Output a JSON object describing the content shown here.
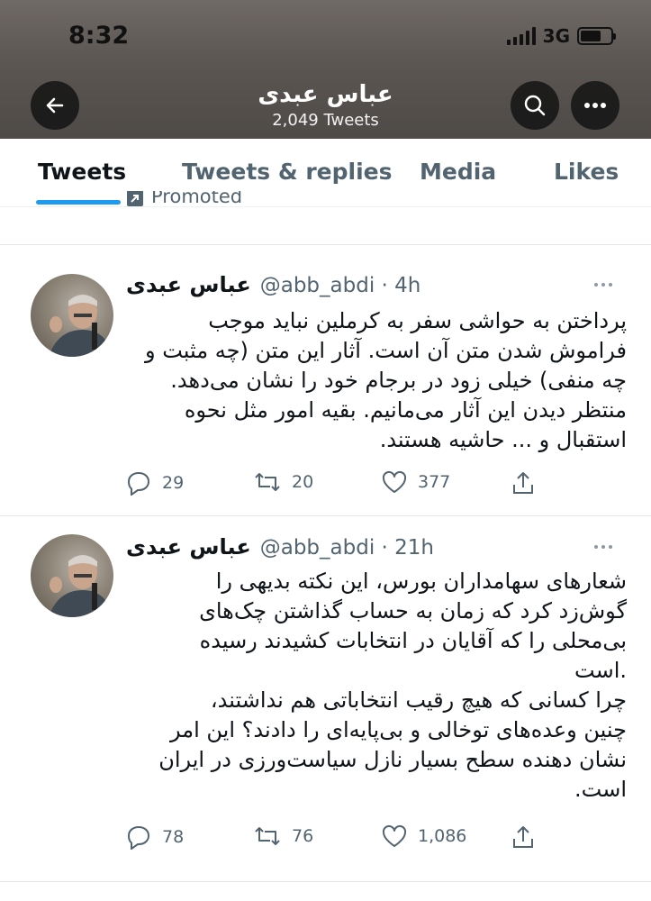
{
  "status_bar": {
    "time": "8:32",
    "network": "3G"
  },
  "header": {
    "name": "عباس عبدی",
    "tweet_count": "2,049 Tweets",
    "icons": {
      "back": "back-arrow-icon",
      "search": "search-icon",
      "more": "more-horizontal-icon"
    }
  },
  "tabs": [
    {
      "label": "Tweets",
      "active": true
    },
    {
      "label": "Tweets & replies",
      "active": false
    },
    {
      "label": "Media",
      "active": false
    },
    {
      "label": "Likes",
      "active": false
    }
  ],
  "promoted_label": "Promoted",
  "tweets": [
    {
      "name": "عباس عبدی",
      "handle": "@abb_abdi · 4h",
      "text": "پرداختن به حواشی سفر به کرملین نباید موجب\nفراموش شدن متن آن است. آثار این متن (چه مثبت و\nچه منفی) خیلی زود در برجام خود را نشان می‌دهد.\nمنتظر دیدن این آثار می‌مانیم. بقیه امور مثل نحوه\nاستقبال و ... حاشیه هستند.",
      "replies": "29",
      "retweets": "20",
      "likes": "377"
    },
    {
      "name": "عباس عبدی",
      "handle": "@abb_abdi · 21h",
      "text": "شعارهای سهامداران بورس، این نکته بدیهی را\nگوش‌زد کرد که زمان به حساب گذاشتن چک‌های\nبی‌محلی را که آقایان در انتخابات کشیدند رسیده\n.است\nچرا کسانی که هیچ رقیب انتخاباتی هم نداشتند،\nچنین وعده‌های توخالی و بی‌پایه‌ای را دادند؟ این امر\nنشان دهنده سطح بسیار نازل سیاست‌ورزی در ایران\nاست.",
      "replies": "78",
      "retweets": "76",
      "likes": "1,086"
    }
  ]
}
